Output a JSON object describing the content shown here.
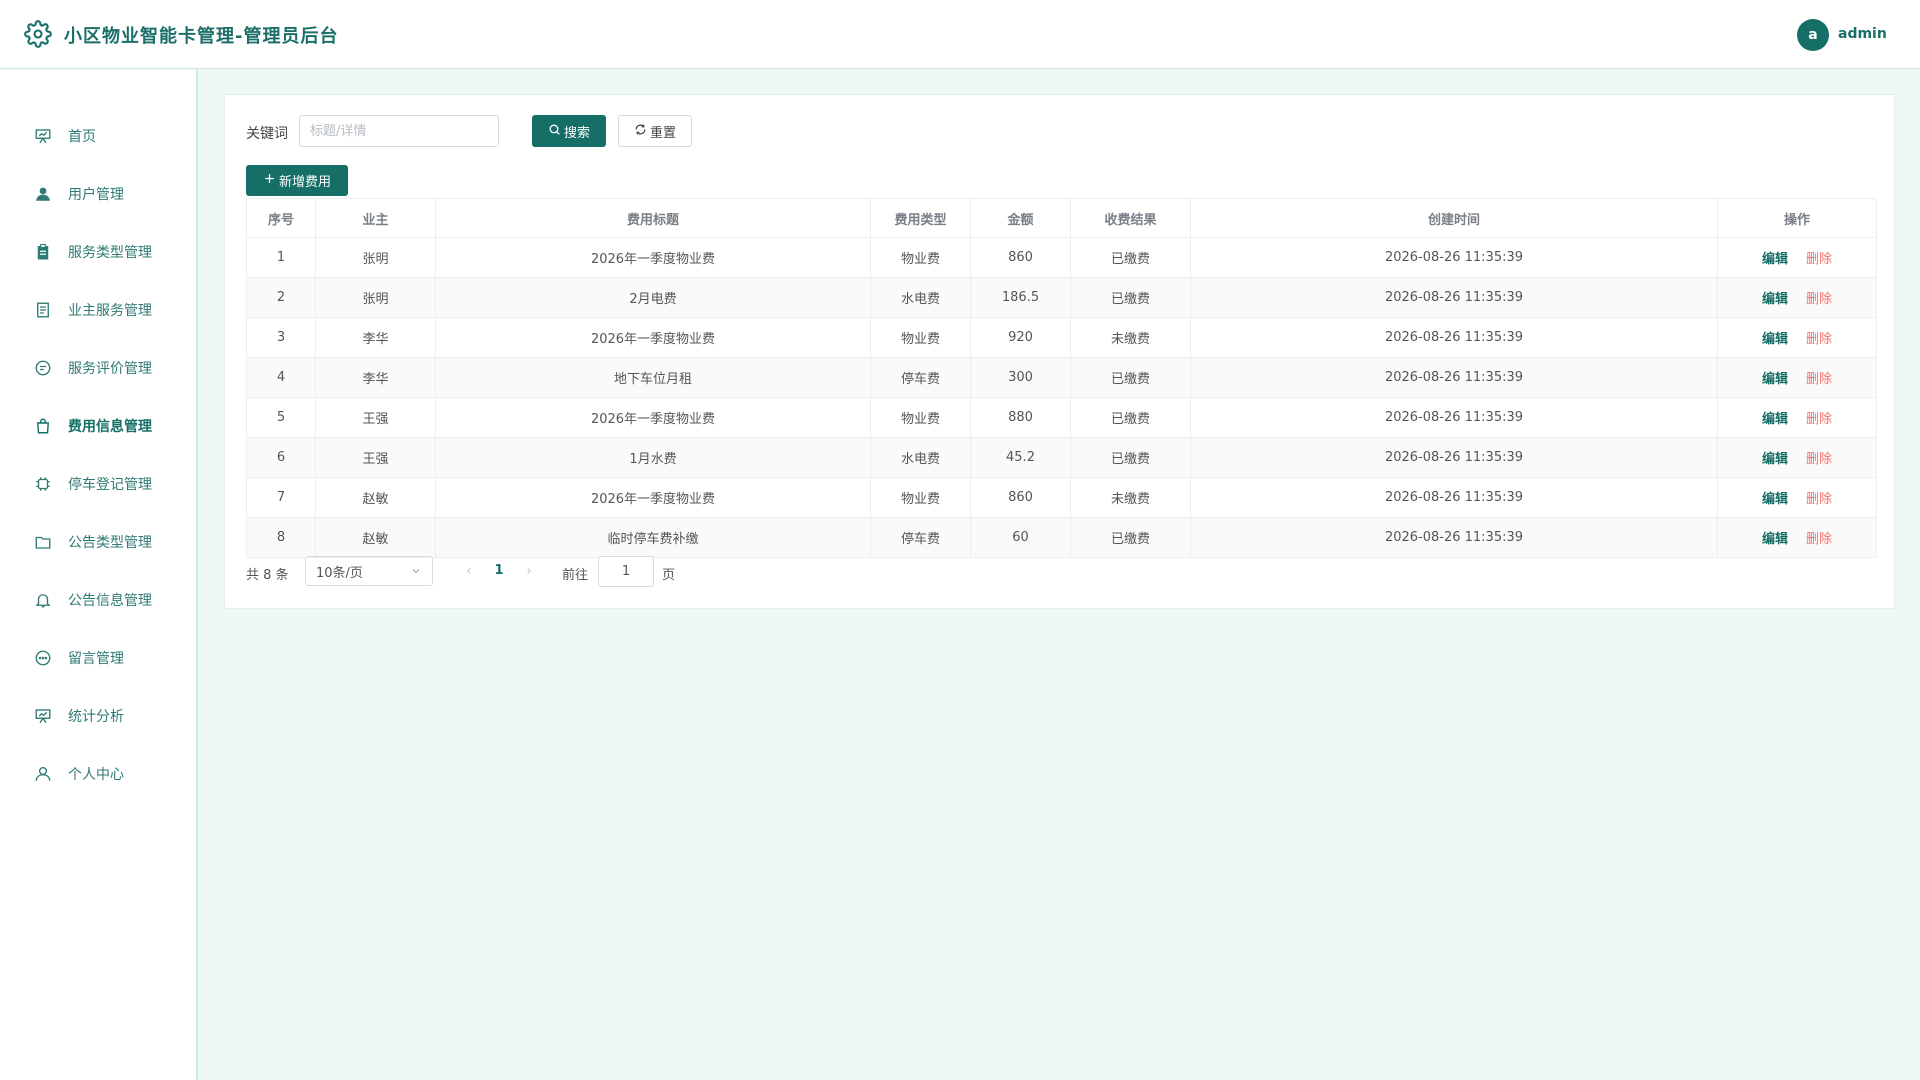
{
  "header": {
    "title": "小区物业智能卡管理-管理员后台",
    "avatar_letter": "a",
    "username": "admin"
  },
  "sidebar": {
    "items": [
      {
        "label": "首页",
        "icon": "presentation-icon"
      },
      {
        "label": "用户管理",
        "icon": "user-icon"
      },
      {
        "label": "服务类型管理",
        "icon": "clipboard-icon"
      },
      {
        "label": "业主服务管理",
        "icon": "document-icon"
      },
      {
        "label": "服务评价管理",
        "icon": "chat-icon"
      },
      {
        "label": "费用信息管理",
        "icon": "bag-icon",
        "active": true
      },
      {
        "label": "停车登记管理",
        "icon": "cpu-icon"
      },
      {
        "label": "公告类型管理",
        "icon": "folder-icon"
      },
      {
        "label": "公告信息管理",
        "icon": "bell-icon"
      },
      {
        "label": "留言管理",
        "icon": "message-icon"
      },
      {
        "label": "统计分析",
        "icon": "presentation-icon"
      },
      {
        "label": "个人中心",
        "icon": "user-outline-icon"
      }
    ]
  },
  "filter": {
    "keyword_label": "关键词",
    "keyword_value": "",
    "keyword_placeholder": "标题/详情",
    "search_label": "搜索",
    "reset_label": "重置",
    "add_label": "新增费用"
  },
  "table": {
    "headers": [
      "序号",
      "业主",
      "费用标题",
      "费用类型",
      "金额",
      "收费结果",
      "创建时间",
      "操作"
    ],
    "edit_label": "编辑",
    "delete_label": "删除",
    "rows": [
      [
        "1",
        "张明",
        "2026年一季度物业费",
        "物业费",
        "860",
        "已缴费",
        "2026-08-26 11:35:39"
      ],
      [
        "2",
        "张明",
        "2月电费",
        "水电费",
        "186.5",
        "已缴费",
        "2026-08-26 11:35:39"
      ],
      [
        "3",
        "李华",
        "2026年一季度物业费",
        "物业费",
        "920",
        "未缴费",
        "2026-08-26 11:35:39"
      ],
      [
        "4",
        "李华",
        "地下车位月租",
        "停车费",
        "300",
        "已缴费",
        "2026-08-26 11:35:39"
      ],
      [
        "5",
        "王强",
        "2026年一季度物业费",
        "物业费",
        "880",
        "已缴费",
        "2026-08-26 11:35:39"
      ],
      [
        "6",
        "王强",
        "1月水费",
        "水电费",
        "45.2",
        "已缴费",
        "2026-08-26 11:35:39"
      ],
      [
        "7",
        "赵敏",
        "2026年一季度物业费",
        "物业费",
        "860",
        "未缴费",
        "2026-08-26 11:35:39"
      ],
      [
        "8",
        "赵敏",
        "临时停车费补缴",
        "停车费",
        "60",
        "已缴费",
        "2026-08-26 11:35:39"
      ]
    ]
  },
  "pagination": {
    "total_text": "共 8 条",
    "page_size": "10条/页",
    "current_page": "1",
    "goto_label": "前往",
    "goto_value": "1",
    "page_suffix": "页"
  },
  "colors": {
    "primary": "#156f66",
    "danger": "#f56c6c",
    "background": "#eef9f6"
  }
}
